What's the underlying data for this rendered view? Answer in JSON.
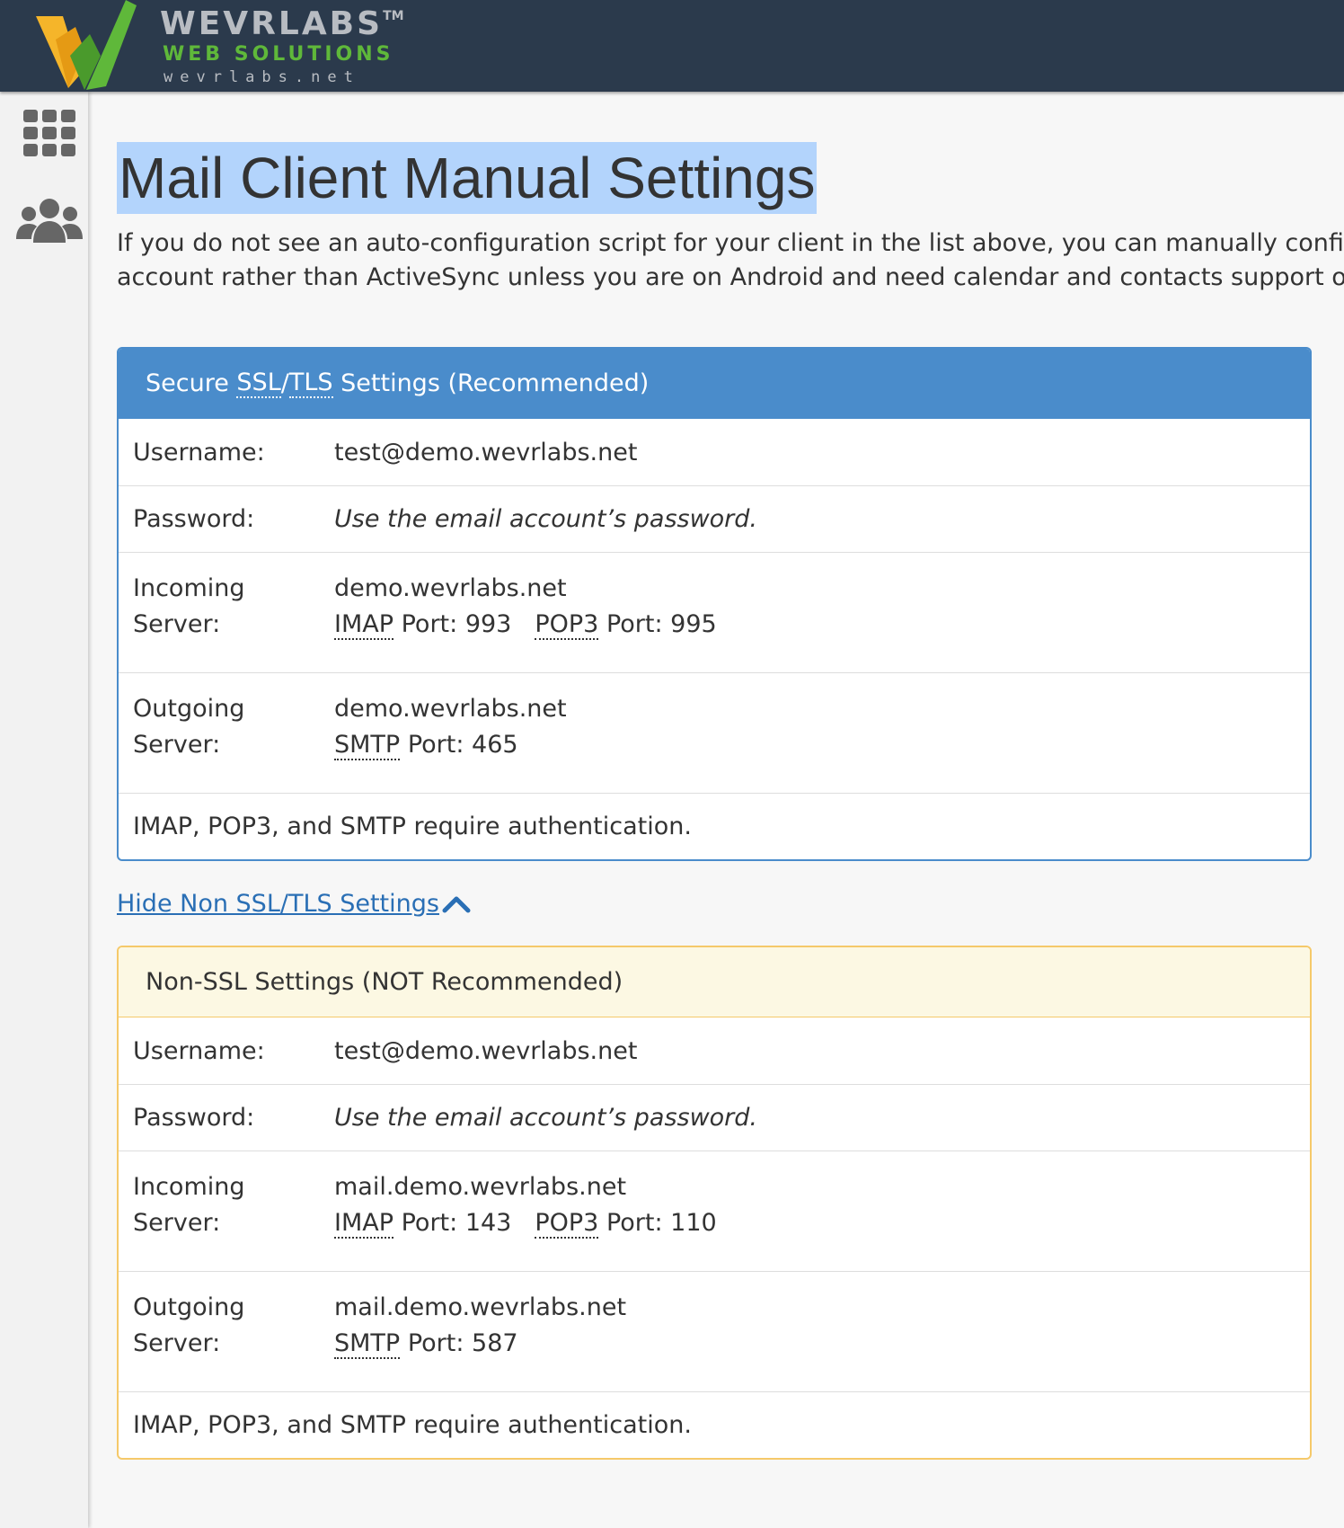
{
  "brand": {
    "name": "WEVRLABS",
    "trademark": "TM",
    "tagline": "WEB SOLUTIONS",
    "url": "wevrlabs.net",
    "colors": {
      "header_bg": "#2b3a4c",
      "green": "#5fb83a",
      "orange": "#f5b52a"
    }
  },
  "sidebar": {
    "items": [
      {
        "icon": "grid-icon"
      },
      {
        "icon": "users-icon"
      }
    ]
  },
  "page": {
    "title": "Mail Client Manual Settings",
    "intro_line1": "If you do not see an auto-configuration script for your client in the list above, you can manually configure",
    "intro_line2": "account rather than ActiveSync unless you are on Android and need calendar and contacts support or pu"
  },
  "secure_panel": {
    "heading_prefix": "Secure",
    "heading_abbr1": "SSL",
    "heading_slash": "/",
    "heading_abbr2": "TLS",
    "heading_suffix": "Settings (Recommended)",
    "color": "#4a8ccb",
    "username_label": "Username:",
    "username_value": "test@demo.wevrlabs.net",
    "password_label": "Password:",
    "password_value": "Use the email account’s password.",
    "incoming_label_1": "Incoming",
    "incoming_label_2": "Server:",
    "incoming_host": "demo.wevrlabs.net",
    "imap_abbr": "IMAP",
    "imap_port": "Port: 993",
    "pop3_abbr": "POP3",
    "pop3_port": "Port: 995",
    "outgoing_label_1": "Outgoing",
    "outgoing_label_2": "Server:",
    "outgoing_host": "demo.wevrlabs.net",
    "smtp_abbr": "SMTP",
    "smtp_port": "Port: 465",
    "auth_note": "IMAP, POP3, and SMTP require authentication."
  },
  "toggle": {
    "label": "Hide Non SSL/TLS Settings ",
    "icon": "chevron-up-icon"
  },
  "nonssl_panel": {
    "heading": "Non-SSL Settings (NOT Recommended)",
    "color": "#f5c96a",
    "username_label": "Username:",
    "username_value": "test@demo.wevrlabs.net",
    "password_label": "Password:",
    "password_value": "Use the email account’s password.",
    "incoming_label_1": "Incoming",
    "incoming_label_2": "Server:",
    "incoming_host": "mail.demo.wevrlabs.net",
    "imap_abbr": "IMAP",
    "imap_port": "Port: 143",
    "pop3_abbr": "POP3",
    "pop3_port": "Port: 110",
    "outgoing_label_1": "Outgoing",
    "outgoing_label_2": "Server:",
    "outgoing_host": "mail.demo.wevrlabs.net",
    "smtp_abbr": "SMTP",
    "smtp_port": "Port: 587",
    "auth_note": "IMAP, POP3, and SMTP require authentication."
  }
}
